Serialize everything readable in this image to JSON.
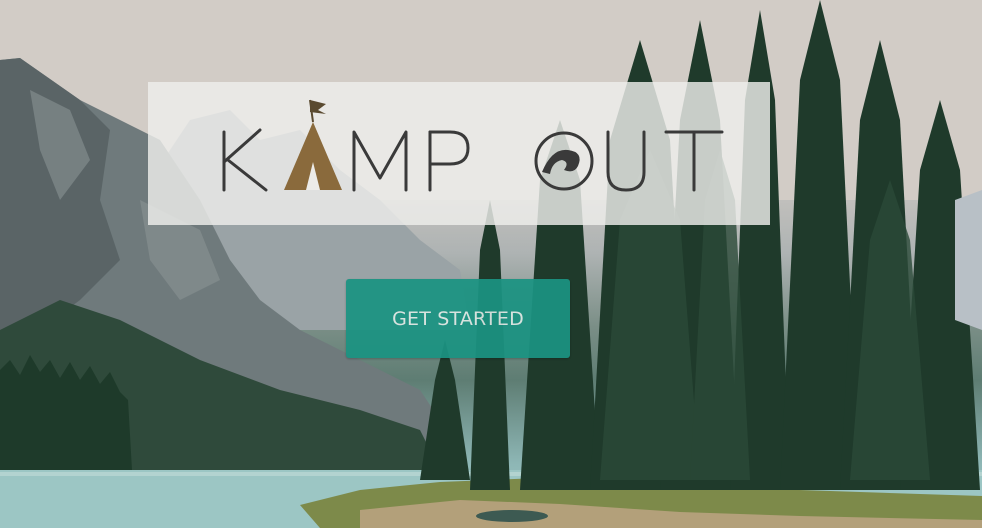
{
  "logo": {
    "text": "KAMP OUT",
    "brand_color": "#8a6a3c"
  },
  "hero": {
    "cta_label": "GET STARTED",
    "cta_color": "#1b9382"
  },
  "background": {
    "description_icon": "mountain-lake-forest-image"
  }
}
